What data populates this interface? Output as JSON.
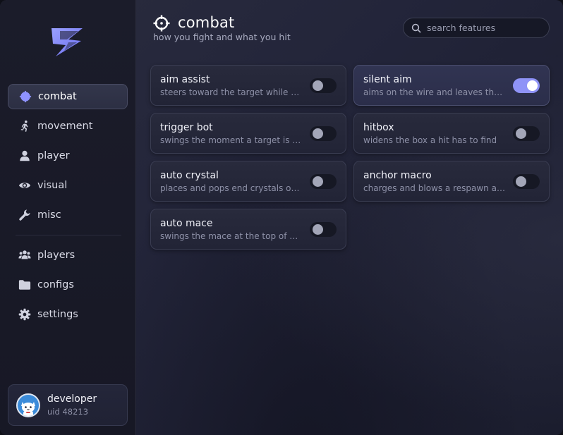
{
  "accent_color": "#8f93f7",
  "sidebar": {
    "logo_icon": "lightning-s-logo",
    "items": [
      {
        "label": "combat",
        "icon": "crosshair-icon",
        "active": true
      },
      {
        "label": "movement",
        "icon": "running-person-icon",
        "active": false
      },
      {
        "label": "player",
        "icon": "person-icon",
        "active": false
      },
      {
        "label": "visual",
        "icon": "eye-icon",
        "active": false
      },
      {
        "label": "misc",
        "icon": "wrench-icon",
        "active": false
      },
      {
        "label": "players",
        "icon": "people-icon",
        "active": false
      },
      {
        "label": "configs",
        "icon": "folder-icon",
        "active": false
      },
      {
        "label": "settings",
        "icon": "gear-icon",
        "active": false
      }
    ],
    "user": {
      "name": "developer",
      "uid": "uid 48213",
      "avatar_icon": "cat-avatar"
    }
  },
  "header": {
    "title": "combat",
    "subtitle": "how you fight and what you hit",
    "icon": "crosshair-icon"
  },
  "search": {
    "placeholder": "search features",
    "value": ""
  },
  "features": [
    {
      "title": "aim assist",
      "desc": "steers toward the target while held",
      "enabled": false
    },
    {
      "title": "silent aim",
      "desc": "aims on the wire and leaves the camera alone",
      "enabled": true
    },
    {
      "title": "trigger bot",
      "desc": "swings the moment a target is under the crosshair",
      "enabled": false
    },
    {
      "title": "hitbox",
      "desc": "widens the box a hit has to find",
      "enabled": false
    },
    {
      "title": "auto crystal",
      "desc": "places and pops end crystals on target",
      "enabled": false
    },
    {
      "title": "anchor macro",
      "desc": "charges and blows a respawn anchor",
      "enabled": false
    },
    {
      "title": "auto mace",
      "desc": "swings the mace at the top of a fall",
      "enabled": false
    }
  ]
}
